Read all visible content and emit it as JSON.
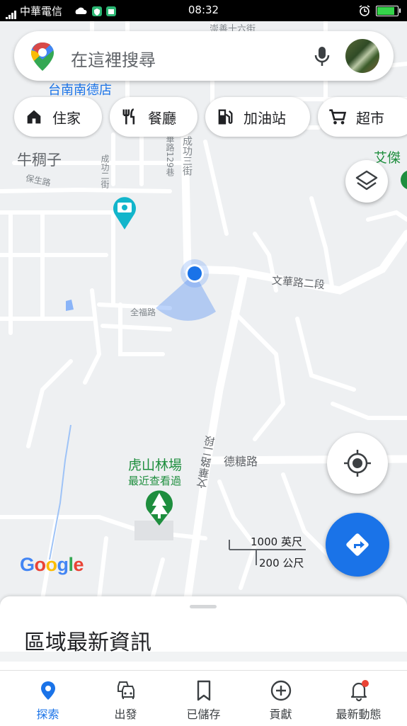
{
  "status_bar": {
    "carrier": "中華電信",
    "time": "08:32"
  },
  "search": {
    "placeholder": "在這裡搜尋"
  },
  "chips": [
    {
      "label": "住家",
      "icon": "home-icon"
    },
    {
      "label": "餐廳",
      "icon": "restaurant-icon"
    },
    {
      "label": "加油站",
      "icon": "gas-station-icon"
    },
    {
      "label": "超市",
      "icon": "cart-icon"
    }
  ],
  "map_labels": {
    "road_wenhua": "文華路二段",
    "road_wenhua_vertical": "文華路二段",
    "road_detang": "德糖路",
    "road_quanfu": "全福路",
    "road_baosheng": "保生路",
    "road_chenggong2": "成功二街",
    "road_chenggong3": "成功三街",
    "road_lane": "華路129巷",
    "area_niuchouzi": "牛稠子",
    "place_top": "台南南德店",
    "place_aijie": "艾傑",
    "forest_name": "虎山林場",
    "forest_sub": "最近查看過",
    "top_street": "崇善十六街"
  },
  "scale": {
    "imperial": "1000 英尺",
    "metric": "200 公尺"
  },
  "google_logo": "Google",
  "sheet": {
    "title": "區域最新資訊"
  },
  "nav": [
    {
      "label": "探索",
      "icon": "explore-pin-icon",
      "active": true
    },
    {
      "label": "出發",
      "icon": "car-icon"
    },
    {
      "label": "已儲存",
      "icon": "bookmark-icon"
    },
    {
      "label": "貢獻",
      "icon": "add-circle-icon"
    },
    {
      "label": "最新動態",
      "icon": "notification-bell-icon"
    }
  ],
  "colors": {
    "accent": "#1a73e8",
    "forest": "#1e8e3e",
    "photo_pin": "#12b5cb"
  }
}
